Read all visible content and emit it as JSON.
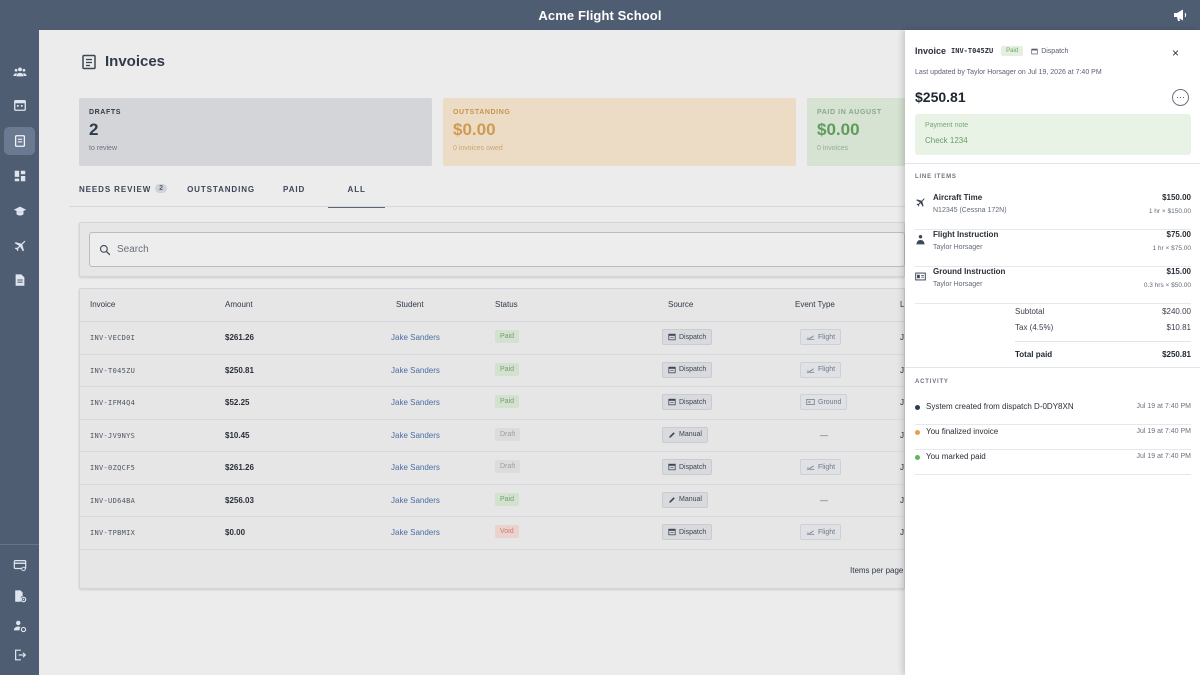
{
  "app": {
    "title": "Acme Flight School"
  },
  "page": {
    "title": "Invoices"
  },
  "summary": {
    "drafts": {
      "label": "DRAFTS",
      "value": "2",
      "sub": "to review"
    },
    "outstanding": {
      "label": "OUTSTANDING",
      "value": "$0.00",
      "sub": "0 invoices owed"
    },
    "paid": {
      "label": "PAID IN AUGUST",
      "value": "$0.00",
      "sub": "0 invoices"
    }
  },
  "tabs": [
    {
      "label": "NEEDS REVIEW",
      "badge": "2"
    },
    {
      "label": "OUTSTANDING"
    },
    {
      "label": "PAID"
    },
    {
      "label": "ALL",
      "active": true
    }
  ],
  "search": {
    "placeholder": "Search"
  },
  "table": {
    "columns": [
      "Invoice",
      "Amount",
      "Student",
      "Status",
      "Source",
      "Event Type",
      "L"
    ],
    "rows": [
      {
        "invoice": "INV-VECD0I",
        "amount": "$261.26",
        "student": "Jake Sanders",
        "status": "Paid",
        "source": "Dispatch",
        "event": "Flight",
        "trunc": "J"
      },
      {
        "invoice": "INV-T045ZU",
        "amount": "$250.81",
        "student": "Jake Sanders",
        "status": "Paid",
        "source": "Dispatch",
        "event": "Flight",
        "trunc": "J"
      },
      {
        "invoice": "INV-IFM4Q4",
        "amount": "$52.25",
        "student": "Jake Sanders",
        "status": "Paid",
        "source": "Dispatch",
        "event": "Ground",
        "trunc": "J"
      },
      {
        "invoice": "INV-JV9NYS",
        "amount": "$10.45",
        "student": "Jake Sanders",
        "status": "Draft",
        "source": "Manual",
        "event": "—",
        "trunc": "J"
      },
      {
        "invoice": "INV-0ZQCF5",
        "amount": "$261.26",
        "student": "Jake Sanders",
        "status": "Draft",
        "source": "Dispatch",
        "event": "Flight",
        "trunc": "J"
      },
      {
        "invoice": "INV-UD64BA",
        "amount": "$256.03",
        "student": "Jake Sanders",
        "status": "Paid",
        "source": "Manual",
        "event": "—",
        "trunc": "J"
      },
      {
        "invoice": "INV-TPBMIX",
        "amount": "$0.00",
        "student": "Jake Sanders",
        "status": "Void",
        "source": "Dispatch",
        "event": "Flight",
        "trunc": "J"
      }
    ],
    "items_per_page": "Items per page"
  },
  "panel": {
    "title": "Invoice",
    "invoice_id": "INV-T045ZU",
    "status": "Paid",
    "source": "Dispatch",
    "updated": "Last updated by Taylor Horsager on Jul 19, 2026 at 7:40 PM",
    "total": "$250.81",
    "more": "···",
    "close": "×",
    "note_label": "Payment note",
    "note_value": "Check 1234",
    "line_items_label": "LINE ITEMS",
    "line_items": [
      {
        "icon": "airplane-icon",
        "name": "Aircraft Time",
        "sub": "N12345 (Cessna 172N)",
        "price": "$150.00",
        "qty": "1 hr × $150.00"
      },
      {
        "icon": "instructor-icon",
        "name": "Flight Instruction",
        "sub": "Taylor Horsager",
        "price": "$75.00",
        "qty": "1 hr × $75.00"
      },
      {
        "icon": "classroom-icon",
        "name": "Ground Instruction",
        "sub": "Taylor Horsager",
        "price": "$15.00",
        "qty": "0.3 hrs × $50.00"
      }
    ],
    "subtotal_label": "Subtotal",
    "subtotal": "$240.00",
    "tax_label": "Tax (4.5%)",
    "tax": "$10.81",
    "total_paid_label": "Total paid",
    "total_paid": "$250.81",
    "activity_label": "ACTIVITY",
    "activity": [
      {
        "text": "System created from dispatch D-0DY8XN",
        "time": "Jul 19 at 7:40 PM",
        "color": "#2f3a55"
      },
      {
        "text": "You finalized invoice",
        "time": "Jul 19 at 7:40 PM",
        "color": "#e8a04a"
      },
      {
        "text": "You marked paid",
        "time": "Jul 19 at 7:40 PM",
        "color": "#5fb65a"
      }
    ]
  }
}
